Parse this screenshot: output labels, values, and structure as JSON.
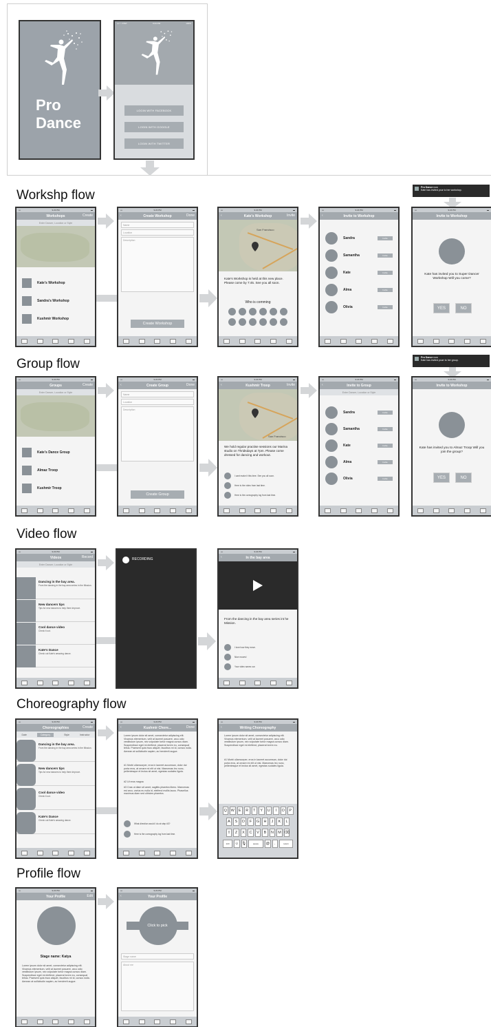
{
  "intro": {
    "splash_title": "Pro\nDance",
    "status": {
      "carrier": "•••○○ AT&T",
      "time": "9:23 PM",
      "battery": "100%"
    },
    "login_facebook": "LOGIN WITH FACEBOOK",
    "login_google": "LOGIN WITH GOOGLE",
    "login_twitter": "LOGIN WITH TWITTER"
  },
  "sections": {
    "workshop": "Workshp flow",
    "group": "Group flow",
    "video": "Video flow",
    "choreography": "Choreography flow",
    "profile": "Profile flow"
  },
  "workshop": {
    "list": {
      "title": "Workshops",
      "right": "Create",
      "search": "Enter Dancer, Location or Style",
      "items": [
        "Kate's Workshop",
        "Sandra's Workshop",
        "Kushmir Workshop"
      ]
    },
    "create": {
      "title": "Create Workshop",
      "right": "Done",
      "fields": [
        "Name",
        "Location",
        "Description"
      ],
      "button": "Create Workshop"
    },
    "detail": {
      "title": "Kate's Workshop",
      "right": "Invite",
      "map_label": "San Francisco",
      "text": "Kate's Workshop is held at this new place. Please come by 7:45. See you all soon.",
      "who": "Who is comming"
    },
    "invite": {
      "title": "Invite to Workshop",
      "people": [
        "Sandra",
        "Samantha",
        "Kate",
        "Alma",
        "Olivia"
      ],
      "invite_label": "Invite"
    },
    "notification": {
      "app": "Pro Dance",
      "time": "now",
      "message": "Kate has invited your to her workshop."
    },
    "accept": {
      "title": "Invite to Workshop",
      "text": "Kate has invited you to Super Dancer Workshop Will you come?",
      "yes": "YES",
      "no": "NO"
    }
  },
  "group": {
    "list": {
      "title": "Groups",
      "right": "Create",
      "search": "Enter Dancer, Location or Style",
      "items": [
        "Kate's Dance Group",
        "Almaz Troop",
        "Kushmir Troop"
      ]
    },
    "create": {
      "title": "Create Group",
      "right": "Done",
      "fields": [
        "Name",
        "Location",
        "Description"
      ],
      "button": "Create Group"
    },
    "detail": {
      "title": "Kushmir Troop",
      "right": "Invite",
      "map_label": "San Francisco",
      "text": "We hold regular practise sessions our Marina studio on Thridsdays at 7pm. Please come dressed for dancing and workout.",
      "comments": [
        "I cant make it this time. See you all soon.",
        "Here is the video from last time.",
        "Here is the coreography log from last time."
      ]
    },
    "invite": {
      "title": "Invite to Group",
      "search": "Enter Dancer, Location or Style",
      "people": [
        "Sandra",
        "Samantha",
        "Kate",
        "Alma",
        "Olivia"
      ],
      "invite_label": "Invite"
    },
    "notification": {
      "app": "Pro Dance",
      "time": "now",
      "message": "Kate has invited yourr to her group."
    },
    "accept": {
      "title": "Invite to Workshop",
      "text": "Kate has invited you to Almaz Troop Will you join the group?",
      "yes": "YES",
      "no": "NO"
    }
  },
  "video": {
    "list": {
      "title": "Videos",
      "right": "Record",
      "search": "Enter Dancer, Location or Style",
      "items": [
        {
          "title": "Dancing in the bay area.",
          "sub": "From the dancing in the bay area series in the Mission."
        },
        {
          "title": "New dancers tips",
          "sub": "Tips for new dancers to help them improve."
        },
        {
          "title": "Cool dance video",
          "sub": "Check it out."
        },
        {
          "title": "Kate's Dance",
          "sub": "Check out Kate's amazing dance."
        }
      ]
    },
    "record": {
      "label": "RECORDING"
    },
    "detail": {
      "title": "In the bay area",
      "text": "From the dancing in the bay area series int he Mission.",
      "comments": [
        "I love how they move.",
        "Nice moves!",
        "Your video saves our."
      ]
    }
  },
  "choreography": {
    "list": {
      "title": "Choreographies",
      "right": "Create",
      "segments": [
        "Date",
        "Category",
        "Style",
        "Instructor"
      ],
      "items": [
        {
          "title": "Dancing in the bay area.",
          "sub": "From the dancing in the bay area series in the Mission."
        },
        {
          "title": "New dancers tips",
          "sub": "Tips for new dancers to help them improve."
        },
        {
          "title": "Cool dance video",
          "sub": "Check it out."
        },
        {
          "title": "Kate's Dance",
          "sub": "Check out Kate's amazing dance."
        }
      ]
    },
    "detail": {
      "title": "Kushmir Chore...",
      "right": "Done",
      "p1": "Lorem ipsum dolor sit amet, consectetur adipiscing elit. Vivamus elementum, velit at laoreet posuere, arcu odio vestibulum ipsum, nec vulputate tortor magna cursus diam. Suspendisse eget mi eleifend, placerat lorem eu, consequat tellus. Praesent quis risus aliquet, faucibus mi id, cursus nulla. Aenean at sollicitudin sapien, ac hendrerit augue.",
      "p2": "#1 Morbi ullamcorper, eros in laoreet accumsan, dolor dui porta eros, at ornare mi elit ut nisi. Maecenas leo nunc, pellentesque et lectus sit amet, egestas sodales ligula.",
      "p3": "#2 Ut eros magna",
      "p4": "#3 Cras ut diam sit amet, sagittis pharetra libero. Maecenas est arcu, varius eu nulla id, eleifend mollis lacus. Phasellus maximus diam sed ultricies pharetra.",
      "comments": [
        "What direction would I do at step #3?",
        "Here is the coreography log from last time."
      ]
    },
    "writing": {
      "title": "Writing Choreography",
      "p1": "Lorem ipsum dolor sit amet, consectetur adipiscing elit. Vivamus elementum, velit at laoreet posuere, arcu odio vestibulum ipsum, nec vulputate tortor magna cursus diam. Suspendisse eget mi eleifend, placerat lorem eu.",
      "p2": "#1 Morbi ullamcorper, eros in laoreet accumsan, dolor dui porta eros, at ornare mi elit ut nisi. Maecenas leo nunc, pellentesque et lectus sit amet, egestas sodales ligula.",
      "keys_row1": [
        "Q",
        "W",
        "E",
        "R",
        "T",
        "Y",
        "U",
        "I",
        "O",
        "P"
      ],
      "keys_row2": [
        "A",
        "S",
        "D",
        "F",
        "G",
        "H",
        "J",
        "K",
        "L"
      ],
      "keys_row3": [
        "Z",
        "X",
        "C",
        "V",
        "B",
        "N",
        "M"
      ],
      "key_123": "123",
      "key_space": "space",
      "key_return": "return"
    }
  },
  "profile": {
    "view": {
      "title": "Your Profile",
      "right": "Edit",
      "stage_name": "Stage name: Katya",
      "bio": "Lorem ipsum dolor sit amet, consectetur adipiscing elit. Vivamus elementum, velit at laoreet posuere, arcu odio vestibulum ipsum, nec vulputate tortor magna cursus diam. Suspendisse eget mi eleifend, placerat lorem eu, consequat tellus. Praesent quis risus aliquet, faucibus mi id, cursus nulla. Aenean at sollicitudin sapien, ac hendrerit augue."
    },
    "edit": {
      "title": "Your Profile",
      "pick": "Click to pick",
      "stage_label": "Stage name",
      "about_label": "About me"
    }
  },
  "colors": {
    "phone_gray": "#a3a9ae",
    "dark_screen": "#2a2a2a",
    "arrow_gray": "#d4d6d8"
  }
}
